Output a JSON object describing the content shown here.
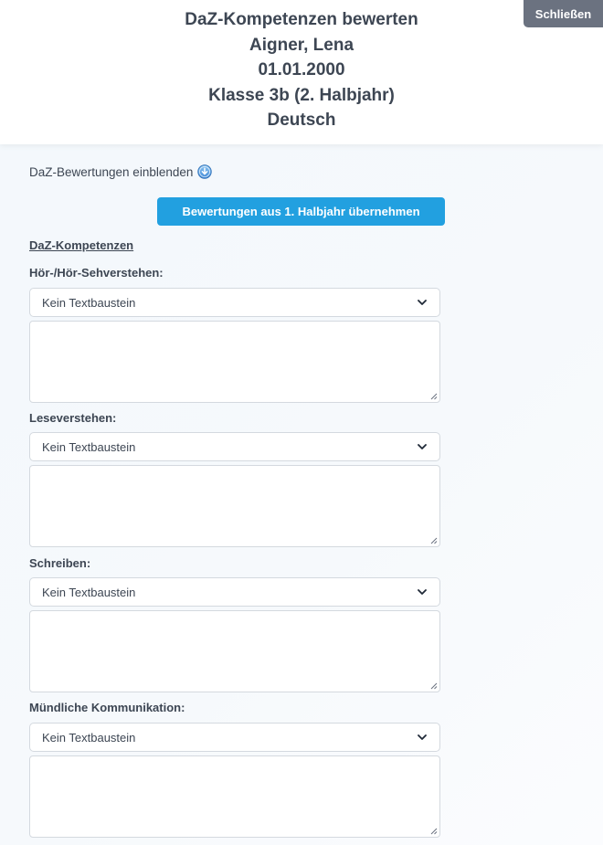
{
  "header": {
    "lines": [
      "DaZ-Kompetenzen bewerten",
      "Aigner, Lena",
      "01.01.2000",
      "Klasse 3b (2. Halbjahr)",
      "Deutsch"
    ],
    "close_label": "Schließen"
  },
  "toggle": {
    "label": "DaZ-Bewertungen einblenden",
    "icon": "circle-arrow-down-icon"
  },
  "copy_button_label": "Bewertungen aus 1. Halbjahr übernehmen",
  "section_title": "DaZ-Kompetenzen",
  "fields": [
    {
      "label": "Hör-/Hör-Sehverstehen:",
      "select_value": "Kein Textbaustein",
      "text": ""
    },
    {
      "label": "Leseverstehen:",
      "select_value": "Kein Textbaustein",
      "text": ""
    },
    {
      "label": "Schreiben:",
      "select_value": "Kein Textbaustein",
      "text": ""
    },
    {
      "label": "Mündliche Kommunikation:",
      "select_value": "Kein Textbaustein",
      "text": ""
    }
  ],
  "colors": {
    "accent": "#22a0e0",
    "close_button": "#6b7280",
    "text": "#3d4653"
  }
}
